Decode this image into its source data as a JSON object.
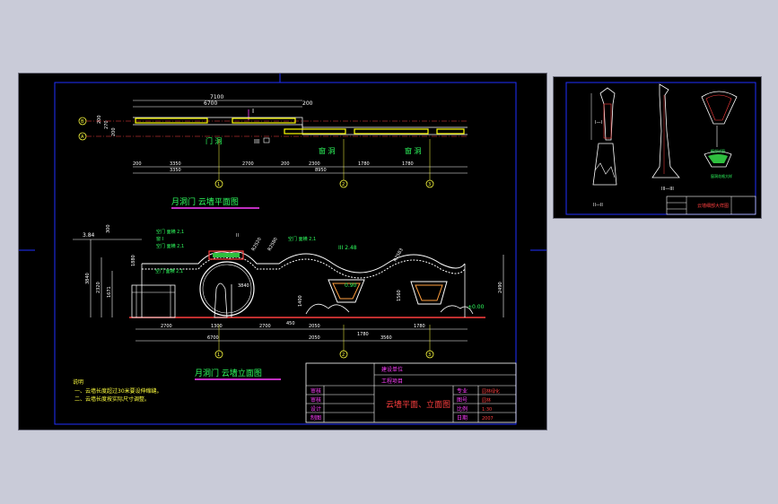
{
  "main_sheet": {
    "plan": {
      "title": "月洞门  云墙平面图",
      "top_dims": [
        "7100",
        "6700",
        "200",
        "200"
      ],
      "section_mark": "I",
      "left_dims": [
        "200",
        "270",
        "200"
      ],
      "axis_left": [
        "B",
        "A"
      ],
      "labels": [
        "门  洞",
        "III",
        "窗  洞",
        "窗  洞"
      ],
      "bottom_dims_row1": [
        "200",
        "3350",
        "2700",
        "200",
        "2300",
        "1780",
        "1780"
      ],
      "bottom_dims_row2": [
        "3350",
        "8950"
      ],
      "axis_bottom": [
        "1",
        "2",
        "3"
      ]
    },
    "elevation": {
      "title": "月洞门  云墙立面图",
      "top_left_dims": [
        "3.84",
        "300"
      ],
      "left_dims": [
        "3840",
        "2320",
        "1671",
        "1880"
      ],
      "callouts": [
        "空门 面横 2,1",
        "空门 面横 2,1",
        "空门 面横 2,1",
        "窗 I",
        "II",
        "III 2.48",
        "R2520",
        "R2580",
        "R2583",
        "空门 面横 2,1",
        "0.90"
      ],
      "right_dims": [
        "2490",
        "1560",
        "±0.00"
      ],
      "bottom_dims_row1": [
        "2700",
        "1300",
        "2700",
        "450",
        "2050",
        "1780",
        "1780"
      ],
      "bottom_dims_row2": [
        "6700",
        "2050",
        "3560"
      ],
      "axis_bottom": [
        "1",
        "2",
        "3"
      ],
      "mid_dims": [
        "3840",
        "1400"
      ]
    },
    "notes": {
      "heading": "说明",
      "items": [
        "一、云墙长度超过30米要设伸缩缝。",
        "二、云墙长度按实际尺寸调整。"
      ]
    },
    "title_block": {
      "project_labels": [
        "建设单位",
        "工程项目"
      ],
      "left_labels": [
        "审核",
        "审核",
        "设计",
        "制图"
      ],
      "drawing_title": "云墙平面、立面图",
      "right_labels": [
        "专业",
        "图号",
        "比例",
        "日期"
      ],
      "right_values": [
        "园林绿化",
        "园林",
        "1:30",
        "2007"
      ]
    }
  },
  "detail_sheet": {
    "section_labels": [
      "I—I",
      "II—II",
      "III—III"
    ],
    "notes": [
      "细部详图",
      "窗洞花格大样"
    ],
    "title_block_label": "云墙细部大样图"
  }
}
